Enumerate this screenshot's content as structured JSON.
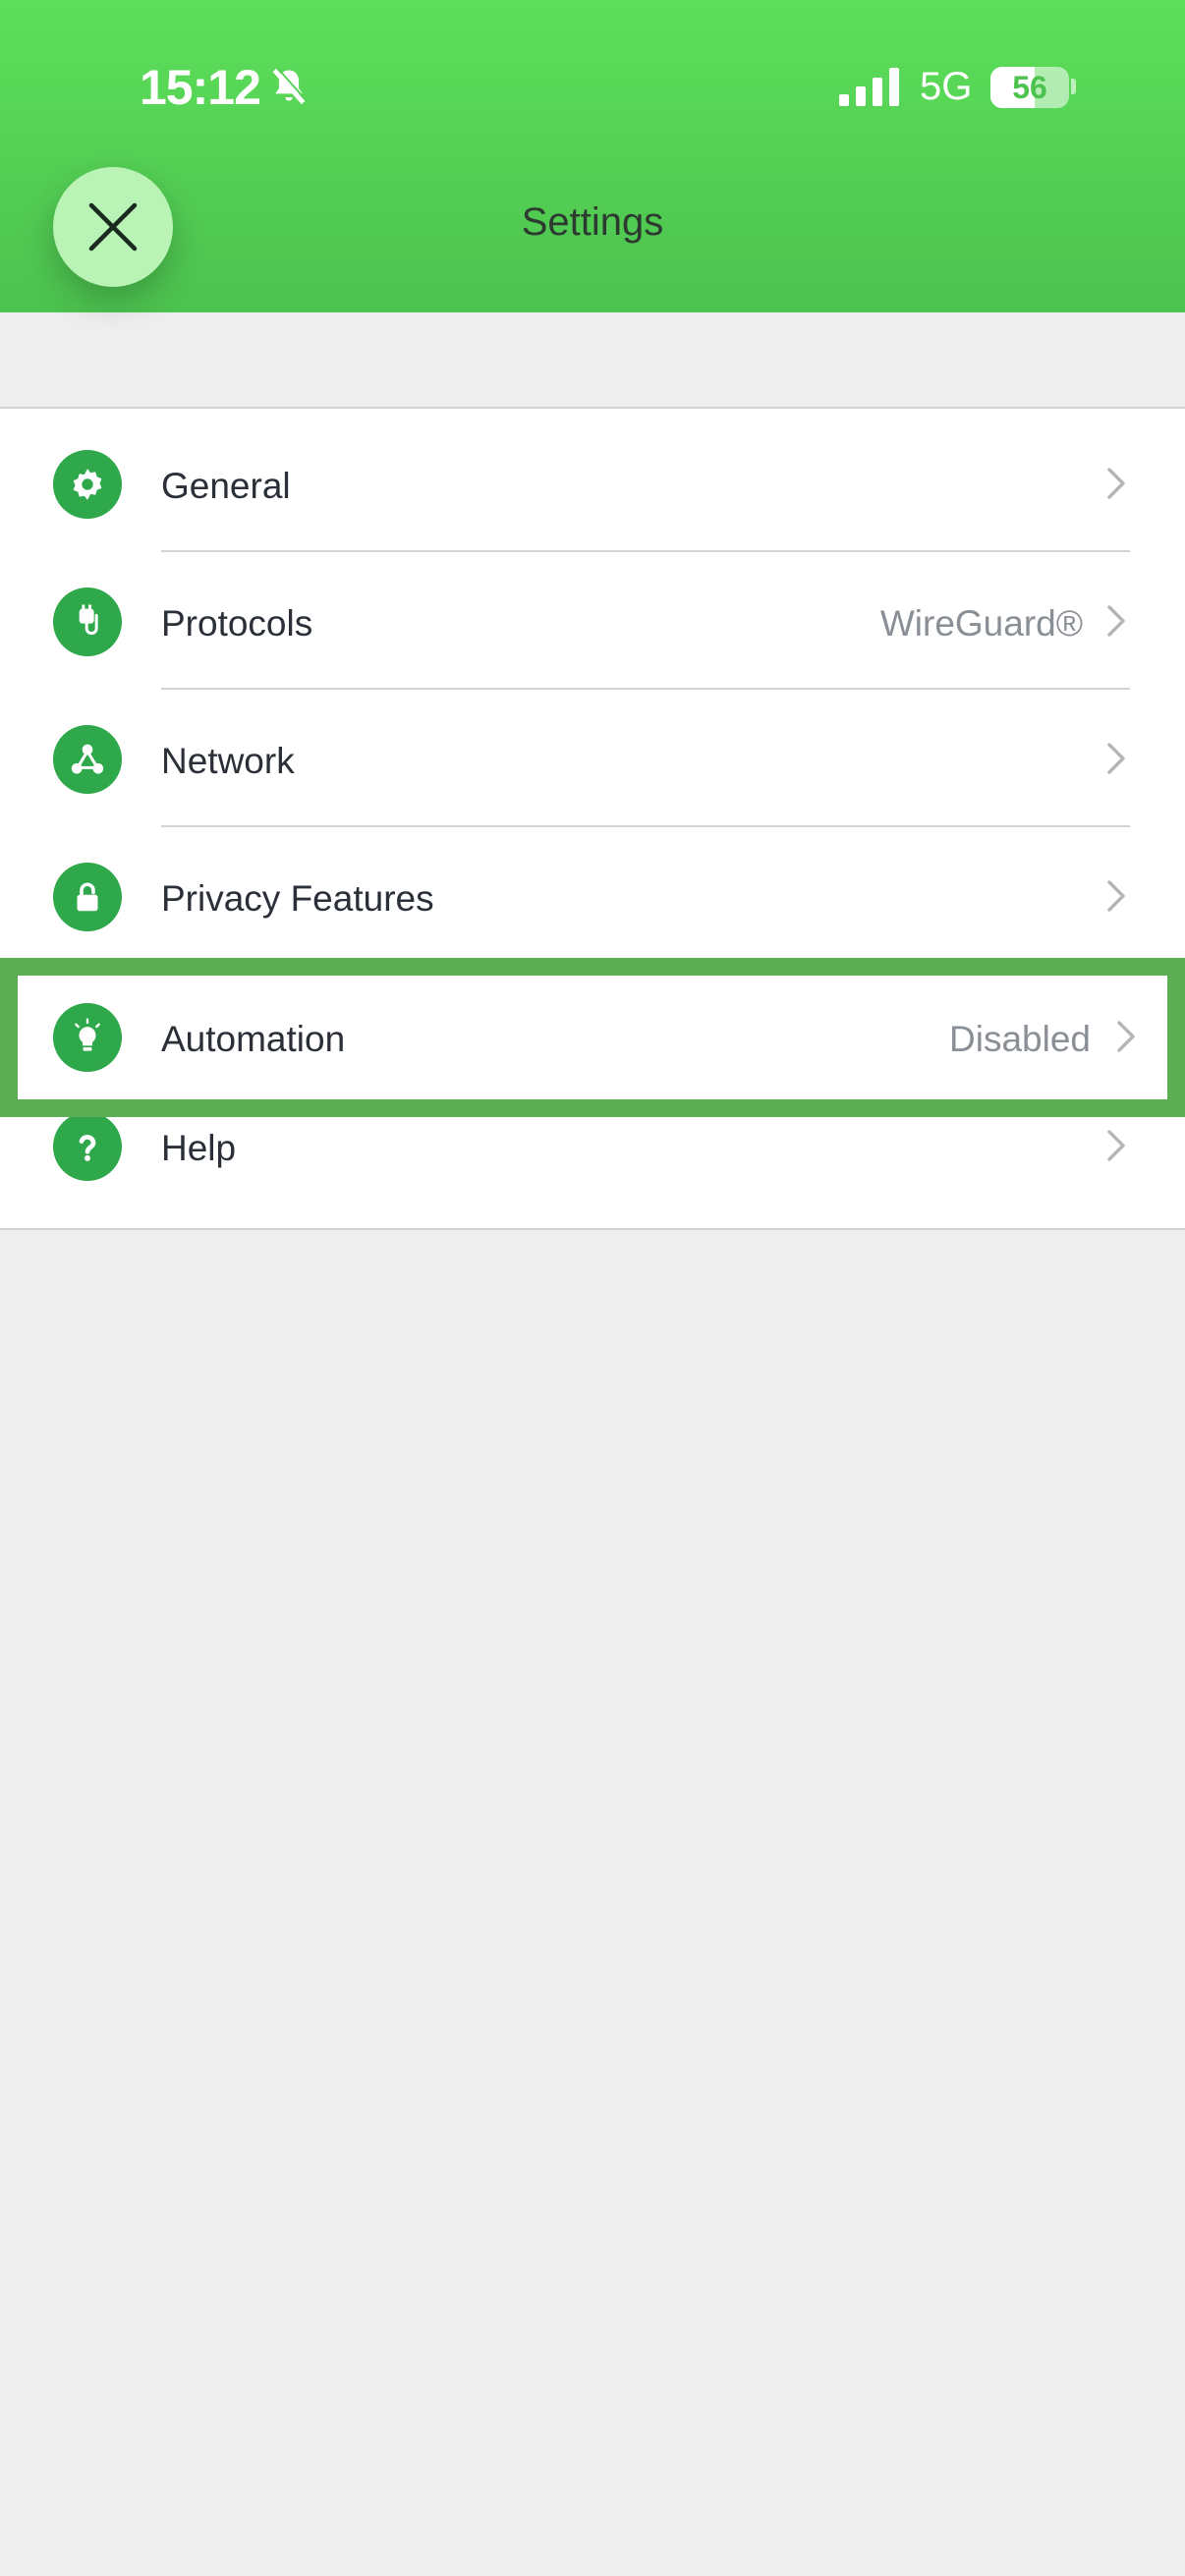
{
  "status_bar": {
    "time": "15:12",
    "network": "5G",
    "battery": 56,
    "icons": [
      "bell-slash-icon",
      "cellular-signal-icon",
      "battery-icon"
    ]
  },
  "header": {
    "title": "Settings",
    "close_icon": "close-icon"
  },
  "settings": {
    "general": {
      "label": "General",
      "icon": "gear-icon"
    },
    "protocols": {
      "label": "Protocols",
      "value": "WireGuard®",
      "icon": "plug-icon"
    },
    "network": {
      "label": "Network",
      "icon": "network-nodes-icon"
    },
    "privacy": {
      "label": "Privacy Features",
      "icon": "lock-icon"
    },
    "automation": {
      "label": "Automation",
      "value": "Disabled",
      "icon": "lightbulb-icon"
    },
    "help": {
      "label": "Help",
      "icon": "question-icon"
    }
  },
  "colors": {
    "header_top": "#5ddf5a",
    "header_bottom": "#4cc24f",
    "icon_green": "#2ea84a",
    "highlight_border": "#5bae54",
    "close_button": "#b9f3b6",
    "background": "#eeeeee"
  }
}
